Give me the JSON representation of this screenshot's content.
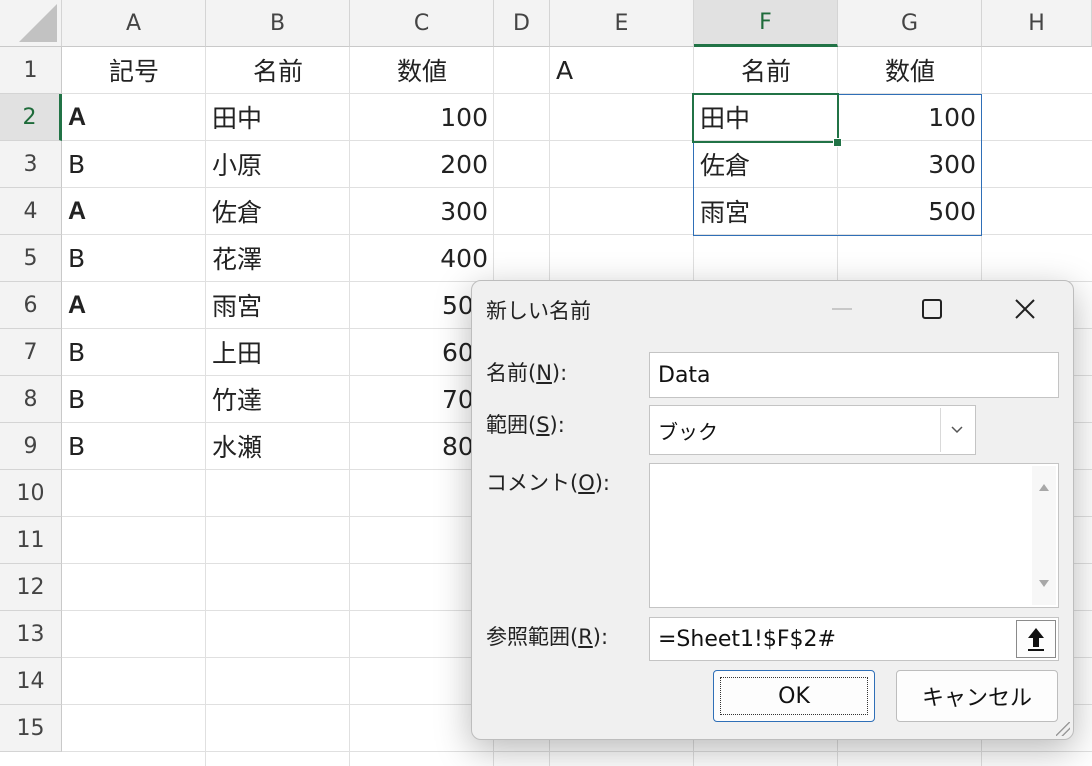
{
  "spreadsheet": {
    "columns": [
      "A",
      "B",
      "C",
      "D",
      "E",
      "F",
      "G",
      "H"
    ],
    "selected_column": "F",
    "rows": [
      "1",
      "2",
      "3",
      "4",
      "5",
      "6",
      "7",
      "8",
      "9",
      "10",
      "11",
      "12",
      "13",
      "14",
      "15"
    ],
    "selected_row": "2",
    "cells": {
      "A1": "記号",
      "B1": "名前",
      "C1": "数値",
      "E1": "A",
      "F1": "名前",
      "G1": "数値",
      "A2": "A",
      "B2": "田中",
      "C2": "100",
      "F2": "田中",
      "G2": "100",
      "A3": "B",
      "B3": "小原",
      "C3": "200",
      "F3": "佐倉",
      "G3": "300",
      "A4": "A",
      "B4": "佐倉",
      "C4": "300",
      "F4": "雨宮",
      "G4": "500",
      "A5": "B",
      "B5": "花澤",
      "C5": "400",
      "A6": "A",
      "B6": "雨宮",
      "C6": "50",
      "A7": "B",
      "B7": "上田",
      "C7": "60",
      "A8": "B",
      "B8": "竹達",
      "C8": "70",
      "A9": "B",
      "B9": "水瀬",
      "C9": "80"
    }
  },
  "dialog": {
    "title": "新しい名前",
    "minimize_icon": "minimize-icon",
    "maximize_icon": "maximize-icon",
    "close_icon": "close-icon",
    "name_label_prefix": "名前(",
    "name_label_key": "N",
    "name_label_suffix": "):",
    "name_value": "Data",
    "scope_label_prefix": "範囲(",
    "scope_label_key": "S",
    "scope_label_suffix": "):",
    "scope_value": "ブック",
    "comment_label_prefix": "コメント(",
    "comment_label_key": "O",
    "comment_label_suffix": "):",
    "comment_value": "",
    "refers_label_prefix": "参照範囲(",
    "refers_label_key": "R",
    "refers_label_suffix": "):",
    "refers_value": "=Sheet1!$F$2#",
    "ok_label": "OK",
    "cancel_label": "キャンセル"
  },
  "colors": {
    "selection_green": "#217346",
    "range_blue": "#2f6fb7"
  }
}
